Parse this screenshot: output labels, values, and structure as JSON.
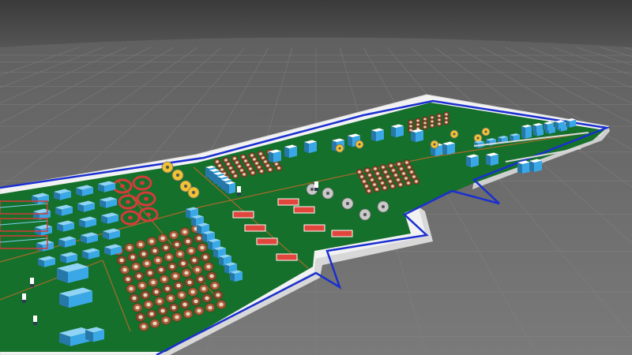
{
  "scene": {
    "colors": {
      "sky": "#3a3a3a",
      "ground": "#6e6e6e",
      "grid_line": "#7c7c7c",
      "wall": "#f2f2f2",
      "wall_shade": "#cfcfcf",
      "floor": "#15702b",
      "floor_dark": "#0f5d22",
      "boundary": "#1a2fd0",
      "aisle": "#b86a2a",
      "machine_blue": "#3aa7e6",
      "machine_light": "#8fd3f5",
      "machine_yellow": "#f1c232",
      "coil_red": "#d43b3b",
      "coil_brown": "#8a4a2b",
      "drum_grey": "#c9c9c9",
      "conveyor_red": "#e0463c"
    }
  }
}
